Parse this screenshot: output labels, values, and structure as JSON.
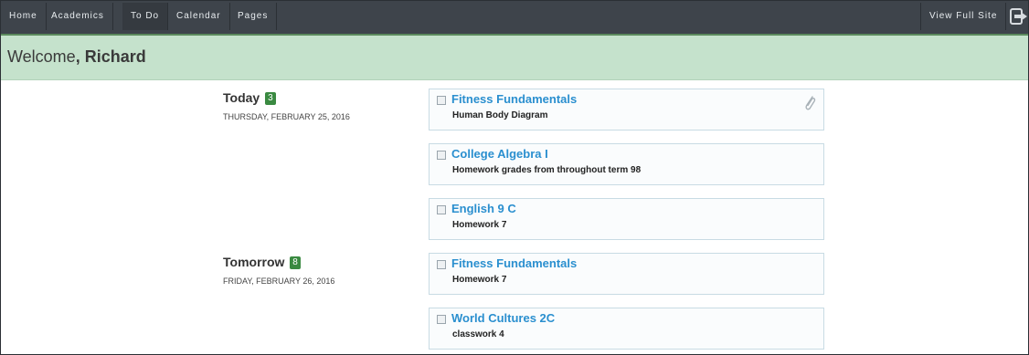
{
  "nav": {
    "items": [
      {
        "label": "Home"
      },
      {
        "label": "Academics"
      },
      {
        "label": "To Do"
      },
      {
        "label": "Calendar"
      },
      {
        "label": "Pages"
      }
    ],
    "active": "To Do",
    "view_full_site": "View Full Site",
    "logout_icon": "logout-icon"
  },
  "welcome": {
    "prefix": "Welcome",
    "name": ", Richard"
  },
  "days": [
    {
      "title": "Today",
      "count": "3",
      "date": "THURSDAY, FEBRUARY 25, 2016",
      "tasks": [
        {
          "course": "Fitness Fundamentals",
          "task": "Human Body Diagram",
          "attachment": true
        },
        {
          "course": "College Algebra I",
          "task": "Homework grades from throughout term 98"
        },
        {
          "course": "English 9 C",
          "task": "Homework 7"
        }
      ]
    },
    {
      "title": "Tomorrow",
      "count": "8",
      "date": "FRIDAY, FEBRUARY 26, 2016",
      "tasks": [
        {
          "course": "Fitness Fundamentals",
          "task": "Homework 7"
        },
        {
          "course": "World Cultures 2C",
          "task": "classwork 4"
        }
      ]
    }
  ],
  "colors": {
    "nav_bg": "#3e444b",
    "welcome_bg": "#c5e2cc",
    "badge": "#3a8a41",
    "course_link": "#2a8fcf"
  }
}
